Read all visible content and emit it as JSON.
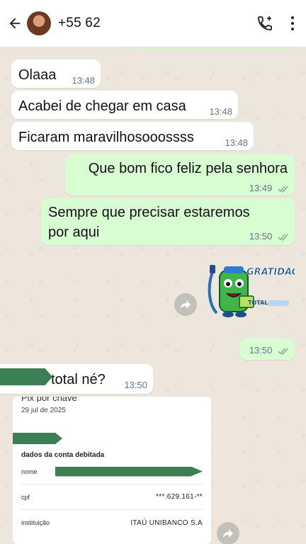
{
  "header": {
    "contact_name": "+55 62",
    "icons": [
      "back-arrow-icon",
      "contact-avatar",
      "add-call-icon",
      "more-options-icon"
    ]
  },
  "messages": [
    {
      "dir": "in",
      "text": "Olaaa",
      "time": "13:48"
    },
    {
      "dir": "in",
      "text": "Acabei de chegar em casa",
      "time": "13:48"
    },
    {
      "dir": "in",
      "text": "Ficaram maravilhosooossss",
      "time": "13:48"
    },
    {
      "dir": "out",
      "text": "Que bom fico feliz pela senhora",
      "time": "13:49"
    },
    {
      "dir": "out",
      "text": "Sempre que precisar estaremos por aqui",
      "time": "13:50"
    },
    {
      "dir": "out",
      "text": "",
      "time": "13:50"
    },
    {
      "dir": "in",
      "text": "total né?",
      "time": "13:50"
    }
  ],
  "sticker": {
    "text": "GRATIDÃO!",
    "brand": "TOTAL"
  },
  "receipt": {
    "heading_cut": "Pix por chave",
    "date": "29 jul de 2025",
    "section": "dados da conta debitada",
    "rows": [
      {
        "label": "nome",
        "value": ""
      },
      {
        "label": "cpf",
        "value": "***.629.161-**"
      },
      {
        "label": "instituição",
        "value": "ITAÚ UNIBANCO S.A"
      }
    ]
  },
  "colors": {
    "incoming_bubble": "#ffffff",
    "outgoing_bubble": "#d9fdd3",
    "read_ticks": "#8aa08a",
    "redaction": "#3c7f55",
    "background": "#ece6dd"
  }
}
